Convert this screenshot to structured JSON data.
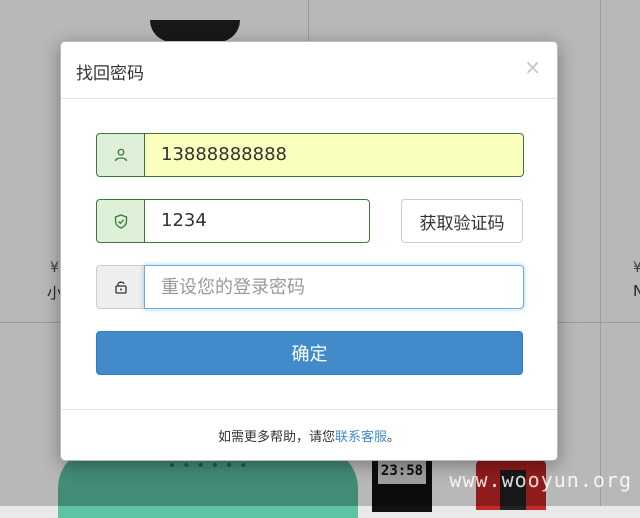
{
  "dialog": {
    "title": "找回密码",
    "close_glyph": "×"
  },
  "form": {
    "phone_value": "13888888888",
    "code_value": "1234",
    "get_code_label": "获取验证码",
    "password_placeholder": "重设您的登录密码",
    "confirm_label": "确定"
  },
  "footer": {
    "text_before": "如需更多帮助，请您",
    "link_label": "联系客服",
    "text_after": "。"
  },
  "icons": {
    "phone_field": "user-icon",
    "code_field": "shield-check-icon",
    "password_field": "lock-icon"
  },
  "background": {
    "price_symbol": "¥",
    "name_left": "小",
    "name_right": "N",
    "watch_display": "23:58"
  },
  "watermark": "www.wooyun.org",
  "colors": {
    "primary": "#428bca",
    "success_border": "#3c763d",
    "success_bg": "#dff0d8",
    "autofill_bg": "#faffbd",
    "focus_border": "#66afe9"
  }
}
